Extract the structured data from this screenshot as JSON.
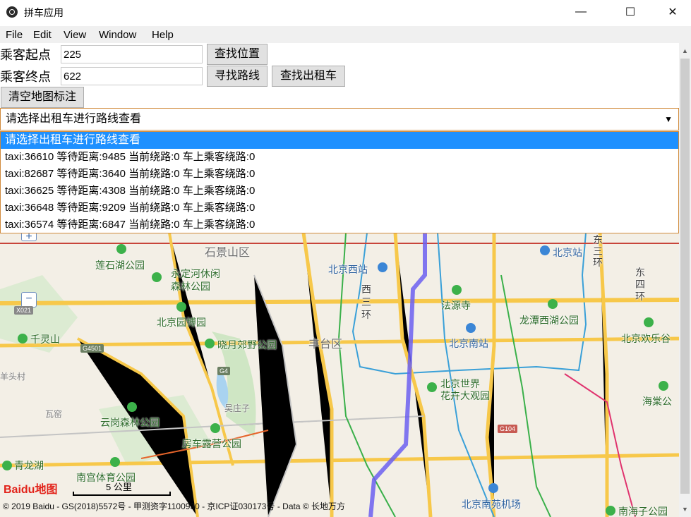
{
  "window": {
    "title": "拼车应用",
    "minimize": "—",
    "maximize": "☐",
    "close": "✕"
  },
  "menu": [
    "File",
    "Edit",
    "View",
    "Window",
    "Help"
  ],
  "form": {
    "start_label": "乘客起点",
    "start_value": "225",
    "end_label": "乘客终点",
    "end_value": "622",
    "find_location_button": "查找位置",
    "find_route_button": "寻找路线",
    "find_taxi_button": "查找出租车",
    "clear_markers_button": "清空地图标注"
  },
  "taxi_select": {
    "selected": "请选择出租车进行路线查看",
    "options": [
      "请选择出租车进行路线查看",
      "taxi:36610 等待距离:9485 当前绕路:0 车上乘客绕路:0",
      "taxi:82687 等待距离:3640 当前绕路:0 车上乘客绕路:0",
      "taxi:36625 等待距离:4308 当前绕路:0 车上乘客绕路:0",
      "taxi:36648 等待距离:9209 当前绕路:0 车上乘客绕路:0",
      "taxi:36574 等待距离:6847 当前绕路:0 车上乘客绕路:0"
    ]
  },
  "map": {
    "labels": {
      "shijingshan": "石景山区",
      "lianshihu": "莲石湖公园",
      "yongding": "永定河休闲",
      "yongding2": "森林公园",
      "beijingwest": "北京西站",
      "beijingstation": "北京站",
      "xisanhuan1": "西",
      "xisanhuan2": "三",
      "xisanhuan3": "环",
      "dongsi1": "东",
      "dongsi2": "四",
      "dongsi3": "环",
      "dongsan1": "东",
      "dongsan2": "三",
      "dongsan3": "环",
      "fayuansi": "法源寺",
      "longtanhu": "龙潭西湖公园",
      "garden": "北京园博园",
      "qianlingshan": "千灵山",
      "xiaoyue": "晓月郊野公园",
      "fengtai": "丰台区",
      "beijingsouth": "北京南站",
      "huanle": "北京欢乐谷",
      "wangzhuang": "羊头村",
      "wanggou": "瓦窑",
      "shijie1": "北京世界",
      "shijie2": "花卉大观园",
      "haitang": "海棠公",
      "yunggang": "云岗森林公园",
      "fangzhuang": "房车露营公园",
      "qinglonghu": "青龙湖",
      "nangong": "南宫体育公园",
      "nanyuan": "北京南苑机场",
      "nanhaizi": "南海子公园",
      "scale": "5 公里",
      "road_g4501": "G4501",
      "road_g4": "G4",
      "road_g104": "G104",
      "road_x021": "X021",
      "wuzhuang": "吴庄子"
    },
    "logo": "Baidu地图",
    "copyright": "© 2019 Baidu - GS(2018)5572号 - 甲测资字1100930 - 京ICP证030173号 - Data © 长地万方",
    "zoom_in": "+",
    "zoom_out": "−"
  }
}
